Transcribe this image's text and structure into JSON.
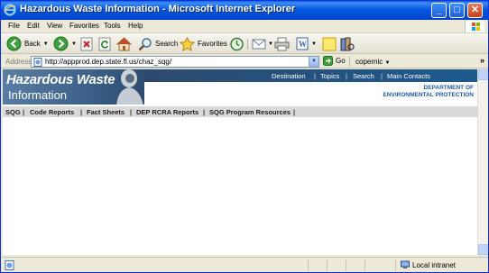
{
  "window": {
    "title": "Hazardous Waste Information - Microsoft Internet Explorer",
    "controls": {
      "minimize": "_",
      "maximize": "□",
      "close": "✕"
    }
  },
  "menu": [
    "File",
    "Edit",
    "View",
    "Favorites",
    "Tools",
    "Help"
  ],
  "toolbar": {
    "back_label": "Back",
    "search_label": "Search",
    "favorites_label": "Favorites"
  },
  "address": {
    "label": "Address",
    "url": "http://appprod.dep.state.fl.us/chaz_sqg/",
    "go_label": "Go",
    "extra_toolbar": "copernic"
  },
  "page": {
    "banner_title_line1": "Hazardous Waste",
    "banner_title_line2": "Information",
    "nav_links": [
      "Destination",
      "Topics",
      "Search",
      "Main Contacts"
    ],
    "dept_line1": "DEPARTMENT OF",
    "dept_line2": "ENVIRONMENTAL PROTECTION",
    "sub_links": [
      "SQG",
      "Code Reports",
      "Fact Sheets",
      "DEP RCRA Reports",
      "SQG Program Resources"
    ]
  },
  "status": {
    "zone": "Local intranet"
  },
  "colors": {
    "titlebar": "#0148d0",
    "banner_blue": "#3c6088",
    "dept_text": "#1e5aa0",
    "links_bar": "#d9d9d9"
  }
}
